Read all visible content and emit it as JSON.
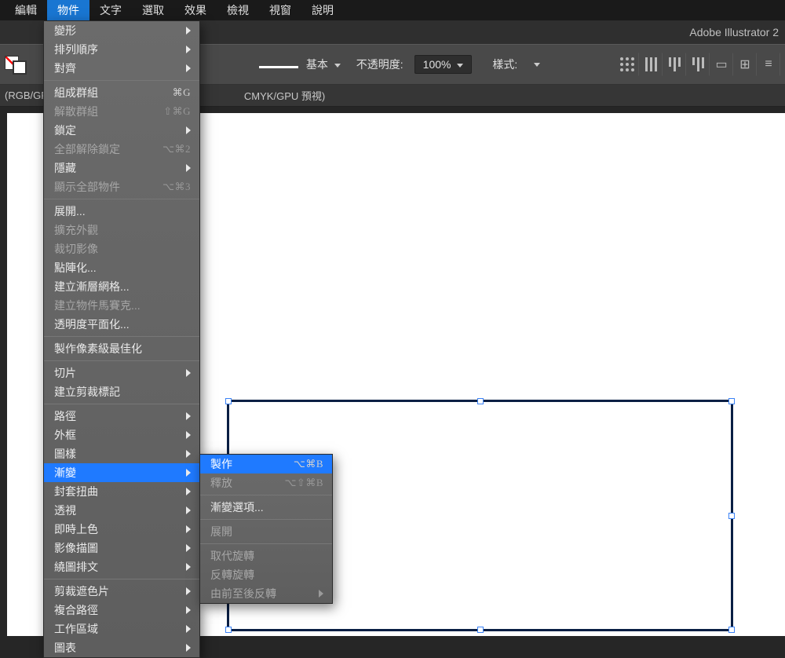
{
  "menubar": {
    "items": [
      "編輯",
      "物件",
      "文字",
      "選取",
      "效果",
      "檢視",
      "視窗",
      "說明"
    ],
    "active_index": 1
  },
  "app_title": "Adobe Illustrator 2",
  "optbar": {
    "stroke_label": "基本",
    "opacity_label": "不透明度:",
    "opacity_value": "100%",
    "style_label": "樣式:"
  },
  "doctabs": {
    "left": "(RGB/GP",
    "right": "CMYK/GPU 預視)"
  },
  "menu": [
    {
      "label": "變形",
      "arrow": true
    },
    {
      "label": "排列順序",
      "arrow": true
    },
    {
      "label": "對齊",
      "arrow": true
    },
    {
      "sep": true
    },
    {
      "label": "組成群組",
      "shortcut": "⌘G"
    },
    {
      "label": "解散群組",
      "shortcut": "⇧⌘G",
      "disabled": true
    },
    {
      "label": "鎖定",
      "arrow": true
    },
    {
      "label": "全部解除鎖定",
      "shortcut": "⌥⌘2",
      "disabled": true
    },
    {
      "label": "隱藏",
      "arrow": true
    },
    {
      "label": "顯示全部物件",
      "shortcut": "⌥⌘3",
      "disabled": true
    },
    {
      "sep": true
    },
    {
      "label": "展開..."
    },
    {
      "label": "擴充外觀",
      "disabled": true
    },
    {
      "label": "裁切影像",
      "disabled": true
    },
    {
      "label": "點陣化..."
    },
    {
      "label": "建立漸層網格..."
    },
    {
      "label": "建立物件馬賽克...",
      "disabled": true
    },
    {
      "label": "透明度平面化..."
    },
    {
      "sep": true
    },
    {
      "label": "製作像素級最佳化"
    },
    {
      "sep": true
    },
    {
      "label": "切片",
      "arrow": true
    },
    {
      "label": "建立剪裁標記"
    },
    {
      "sep": true
    },
    {
      "label": "路徑",
      "arrow": true
    },
    {
      "label": "外框",
      "arrow": true
    },
    {
      "label": "圖樣",
      "arrow": true
    },
    {
      "label": "漸變",
      "arrow": true,
      "highlight": true
    },
    {
      "label": "封套扭曲",
      "arrow": true
    },
    {
      "label": "透視",
      "arrow": true
    },
    {
      "label": "即時上色",
      "arrow": true
    },
    {
      "label": "影像描圖",
      "arrow": true
    },
    {
      "label": "繞圖排文",
      "arrow": true
    },
    {
      "sep": true
    },
    {
      "label": "剪裁遮色片",
      "arrow": true
    },
    {
      "label": "複合路徑",
      "arrow": true
    },
    {
      "label": "工作區域",
      "arrow": true
    },
    {
      "label": "圖表",
      "arrow": true
    }
  ],
  "submenu": [
    {
      "label": "製作",
      "shortcut": "⌥⌘B",
      "highlight": true
    },
    {
      "label": "釋放",
      "shortcut": "⌥⇧⌘B",
      "disabled": true
    },
    {
      "sep": true
    },
    {
      "label": "漸變選項..."
    },
    {
      "sep": true
    },
    {
      "label": "展開",
      "disabled": true
    },
    {
      "sep": true
    },
    {
      "label": "取代旋轉",
      "disabled": true
    },
    {
      "label": "反轉旋轉",
      "disabled": true
    },
    {
      "label": "由前至後反轉",
      "disabled": true,
      "arrow": true
    }
  ]
}
